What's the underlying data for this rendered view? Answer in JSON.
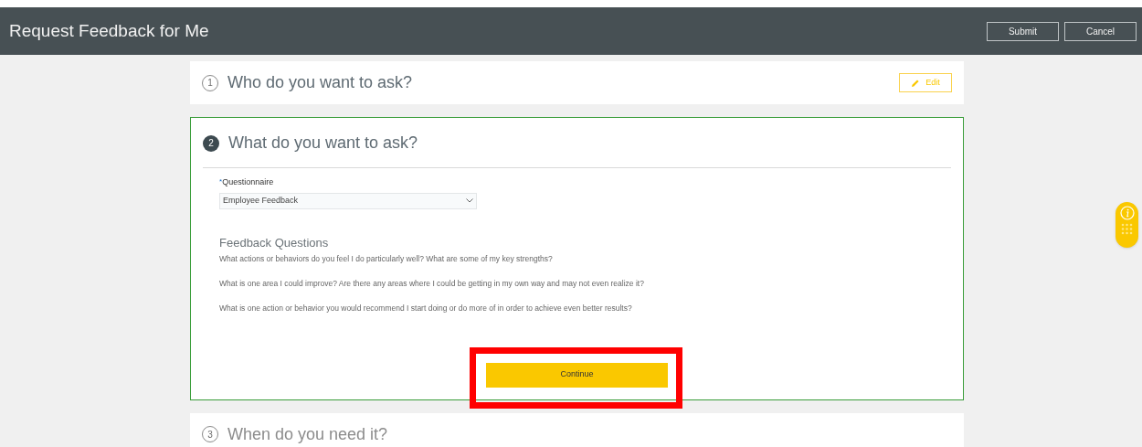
{
  "header": {
    "title": "Request Feedback for Me",
    "buttons": [
      "Submit",
      "Cancel"
    ]
  },
  "steps": [
    {
      "number": "1",
      "title": "Who do you want to ask?",
      "completed": true,
      "selected": false,
      "edit_label": "Edit"
    },
    {
      "number": "2",
      "title": "What do you want to ask?",
      "completed": false,
      "selected": true,
      "field": {
        "label": "Questionnaire",
        "required_mark": "*",
        "value": "Employee Feedback"
      },
      "questions_heading": "Feedback Questions",
      "questions": [
        "What actions or behaviors do you feel I do particularly well? What are some of my key strengths?",
        "What is one area I could improve? Are there any areas where I could be getting in my own way and may not even realize it?",
        "What is one action or behavior you would recommend I start doing or do more of in order to achieve even better results?"
      ],
      "continue_label": "Continue",
      "highlighted": true
    },
    {
      "number": "3",
      "title": "When do you need it?",
      "completed": false,
      "selected": false
    }
  ]
}
